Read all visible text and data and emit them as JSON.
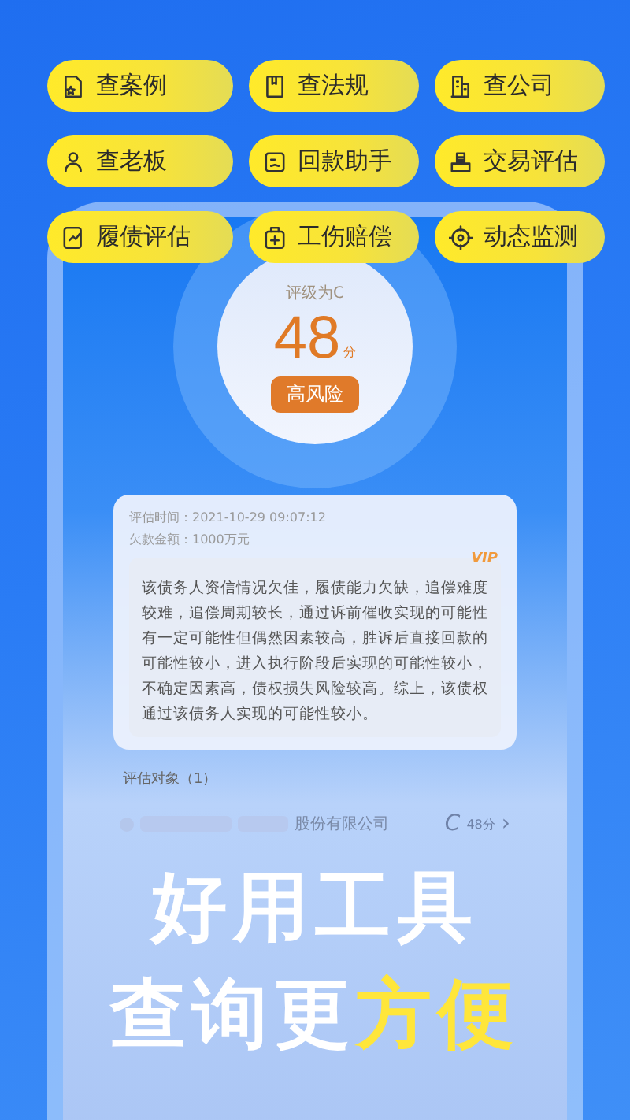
{
  "tools": [
    {
      "label": "查案例"
    },
    {
      "label": "查法规"
    },
    {
      "label": "查公司"
    },
    {
      "label": "查老板"
    },
    {
      "label": "回款助手"
    },
    {
      "label": "交易评估"
    },
    {
      "label": "履债评估"
    },
    {
      "label": "工伤赔偿"
    },
    {
      "label": "动态监测"
    }
  ],
  "score": {
    "grade_label": "评级为C",
    "value": "48",
    "unit": "分",
    "risk": "高风险"
  },
  "report": {
    "time": "评估时间：2021-10-29 09:07:12",
    "amount": "欠款金额：1000万元",
    "badge": "VIP",
    "summary": "该债务人资信情况欠佳，履债能力欠缺，追偿难度较难，追偿周期较长，通过诉前催收实现的可能性有一定可能性但偶然因素较高，胜诉后直接回款的可能性较小，进入执行阶段后实现的可能性较小，不确定因素高，债权损失风险较高。综上，该债权通过该债务人实现的可能性较小。"
  },
  "targets": {
    "title": "评估对象（1）",
    "rows": [
      {
        "name": "股份有限公司",
        "grade": "C",
        "score": "48分",
        "chevron": "›"
      }
    ]
  },
  "headline": {
    "line_1": "好用工具",
    "line_2": [
      {
        "text": "查询更",
        "highlight": false
      },
      {
        "text": "方便",
        "highlight": true
      }
    ]
  }
}
